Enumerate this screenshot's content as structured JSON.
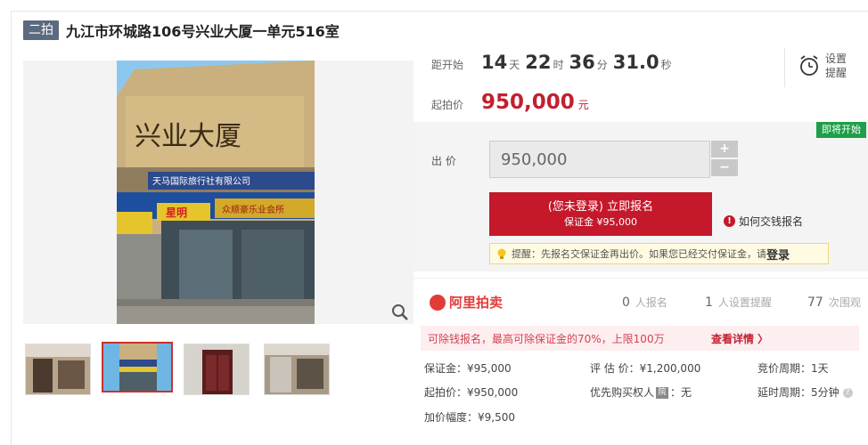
{
  "header": {
    "round_badge": "二拍",
    "title": "九江市环城路106号兴业大厦一单元516室"
  },
  "gallery": {
    "thumbnails": [
      "thumb-1",
      "thumb-2",
      "thumb-3",
      "thumb-4"
    ],
    "active_index": 1,
    "building_sign": "兴业大厦",
    "shop_signs": [
      "天马国际旅行社有限公司",
      "星明",
      "众顺豪乐业会所"
    ]
  },
  "countdown": {
    "label": "距开始",
    "days": "14",
    "days_unit": "天",
    "hours": "22",
    "hours_unit": "时",
    "minutes": "36",
    "minutes_unit": "分",
    "seconds": "31.0",
    "seconds_unit": "秒"
  },
  "reminder": {
    "label": "设置提醒",
    "icon": "alarm-clock-icon"
  },
  "start_price": {
    "label": "起拍价",
    "value": "950,000",
    "unit": "元"
  },
  "bid": {
    "status_tag": "即将开始",
    "label": "出 价",
    "input_value": "950,000",
    "plus": "+",
    "minus": "−",
    "signup_main": "(您未登录) 立即报名",
    "signup_sub": "保证金 ¥95,000",
    "how_pay": "如何交钱报名",
    "tip_text": "提醒：先报名交保证金再出价。如果您已经交付保证金，请",
    "tip_login": "登录"
  },
  "stats": {
    "brand": "阿里拍卖",
    "signups": "0",
    "signups_label": "人报名",
    "reminders": "1",
    "reminders_label": "人设置提醒",
    "views": "77",
    "views_label": "次围观"
  },
  "promo": {
    "text": "可除钱报名，最高可除保证金的70%，上限100万",
    "link": "查看详情 〉"
  },
  "details": {
    "deposit": "保证金：¥95,000",
    "appraisal": "评 估 价：¥1,200,000",
    "cycle": "竞价周期：1天",
    "start": "起拍价：¥950,000",
    "priority": "优先购买权人",
    "priority_value": "：无",
    "priority_icon": "院",
    "delay": "延时周期：5分钟",
    "increment": "加价幅度：¥9,500"
  },
  "colors": {
    "accent_red": "#c5182b",
    "badge_gray": "#5a6a7f",
    "status_green": "#1e9f4a"
  }
}
